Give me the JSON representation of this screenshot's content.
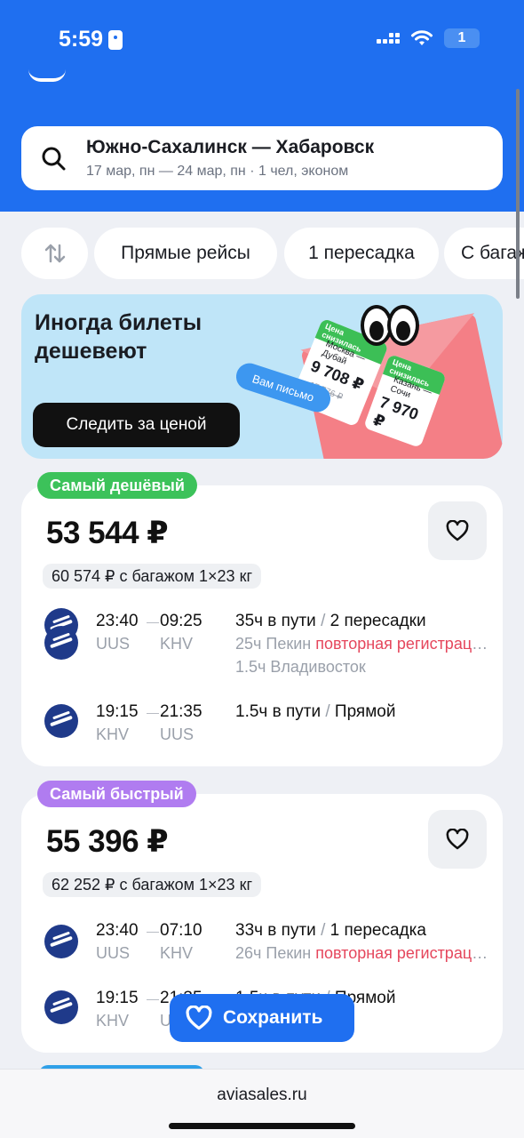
{
  "status_bar": {
    "time": "5:59",
    "battery": "1"
  },
  "search": {
    "route": "Южно-Сахалинск — Хабаровск",
    "details": "17 мар, пн — 24 мар, пн · 1 чел, эконом"
  },
  "filters": {
    "chips": [
      "Прямые рейсы",
      "1 пересадка",
      "С багажом"
    ]
  },
  "banner": {
    "title": "Иногда билеты дешевеют",
    "button": "Следить за ценой",
    "mail_tag": "Вам письмо",
    "ticket1": {
      "tag": "Цена снизилась",
      "route": "Москва — Дубай",
      "price": "9 708 ₽",
      "old_price": "17 776 ₽"
    },
    "ticket2": {
      "tag": "Цена снизилась",
      "route": "Казань — Сочи",
      "price": "7 970 ₽"
    }
  },
  "cards": [
    {
      "badge": "Самый дешёвый",
      "price": "53 544 ₽",
      "baggage_price": "60 574 ₽ с багажом 1×23 кг",
      "outbound": {
        "dep_time": "23:40",
        "arr_time": "09:25",
        "dep_code": "UUS",
        "arr_code": "KHV",
        "duration": "35ч в пути",
        "transfers": "2 пересадки",
        "stop1_duration": "25ч Пекин",
        "stop1_warning": "повторная регистрация",
        "stop2": "1.5ч Владивосток"
      },
      "return": {
        "dep_time": "19:15",
        "arr_time": "21:35",
        "dep_code": "KHV",
        "arr_code": "UUS",
        "duration": "1.5ч в пути",
        "transfers": "Прямой"
      }
    },
    {
      "badge": "Самый быстрый",
      "price": "55 396 ₽",
      "baggage_price": "62 252 ₽ с багажом 1×23 кг",
      "outbound": {
        "dep_time": "23:40",
        "arr_time": "07:10",
        "dep_code": "UUS",
        "arr_code": "KHV",
        "duration": "33ч в пути",
        "transfers": "1 пересадка",
        "stop1_duration": "26ч Пекин",
        "stop1_warning": "повторная регистрация"
      },
      "return": {
        "dep_time": "19:15",
        "arr_time": "21:35",
        "dep_code": "KHV",
        "arr_code": "UUS",
        "duration": "1.5ч в пути",
        "transfers": "Прямой"
      }
    }
  ],
  "save_button": "Сохранить",
  "browser": {
    "url": "aviasales.ru"
  },
  "colors": {
    "brand_blue": "#1f6ff0",
    "cheapest_badge": "#3cc25a",
    "fastest_badge": "#b07cf0",
    "warning": "#e5465c"
  }
}
